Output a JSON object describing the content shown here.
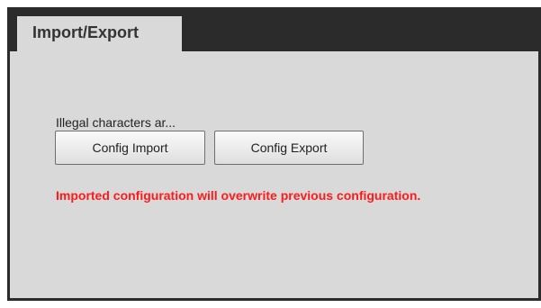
{
  "tab": {
    "label": "Import/Export"
  },
  "panel": {
    "message": "Illegal characters ar...",
    "buttons": {
      "import_label": "Config Import",
      "export_label": "Config Export"
    },
    "warning": "Imported configuration will overwrite previous configuration."
  },
  "colors": {
    "warning": "#ff1a1a",
    "frame": "#2b2b2b",
    "panel": "#d9d9d9"
  }
}
